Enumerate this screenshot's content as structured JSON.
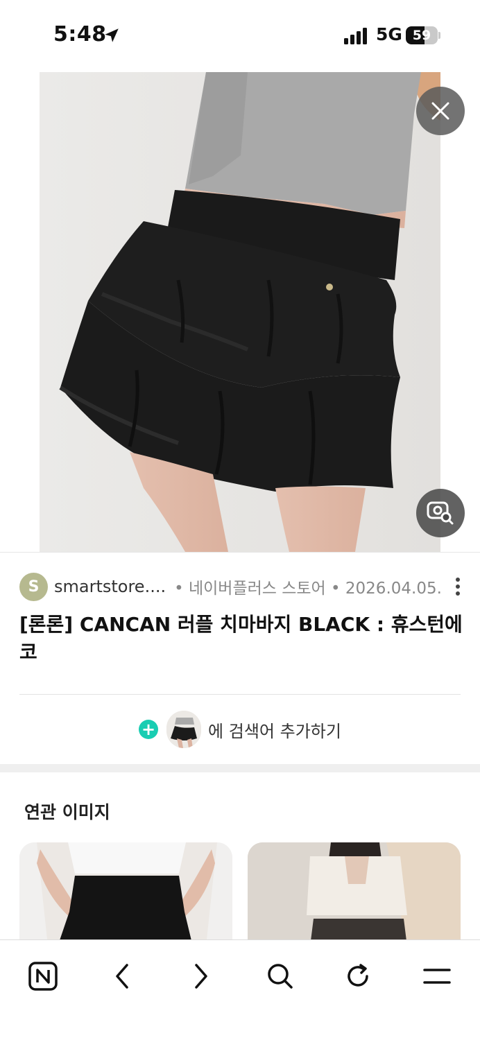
{
  "status_bar": {
    "time": "5:48",
    "network": "5G",
    "battery_level": "59",
    "battery_fraction": 0.59
  },
  "result": {
    "source_initial": "S",
    "source_name": "smartstore....",
    "source_meta": "• 네이버플러스 스토어 • 2026.04.05.",
    "title": "[론론] CANCAN 러플 치마바지 BLACK : 휴스턴에코",
    "add_keyword_label": "에 검색어 추가하기"
  },
  "related": {
    "title": "연관 이미지"
  },
  "icons": {
    "close": "close-icon",
    "lens": "image-search-icon",
    "more": "more-vertical-icon",
    "nav": [
      "naver-home-icon",
      "back-icon",
      "forward-icon",
      "search-icon",
      "reload-icon",
      "menu-icon"
    ]
  },
  "colors": {
    "accent": "#19cdb2",
    "avatar": "#b6b98f"
  }
}
